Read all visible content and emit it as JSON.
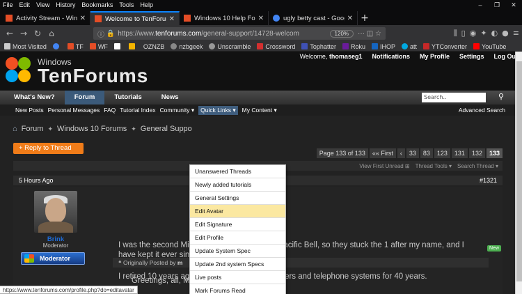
{
  "menubar": [
    "File",
    "Edit",
    "View",
    "History",
    "Bookmarks",
    "Tools",
    "Help"
  ],
  "window_controls": {
    "minimize": "–",
    "restore": "❐",
    "close": "✕"
  },
  "tabs": [
    {
      "title": "Activity Stream - Windows",
      "favicon_color": "#e44d26",
      "active": false
    },
    {
      "title": "Welcome to TenForums - h",
      "favicon_color": "#e44d26",
      "active": true
    },
    {
      "title": "Windows 10 Help Forums",
      "favicon_color": "#e44d26",
      "active": false
    },
    {
      "title": "ugly betty cast - Google Se",
      "favicon_color": "#4285f4",
      "active": false
    }
  ],
  "toolbar": {
    "url_prefix": "https://www.",
    "url_host": "tenforums.com",
    "url_path": "/general-support/14728-welcom",
    "zoom": "120%"
  },
  "bookmarks": [
    {
      "label": "Most Visited",
      "color": "#ccc"
    },
    {
      "label": "",
      "color": "#4285f4"
    },
    {
      "label": "TF",
      "color": "#e44d26"
    },
    {
      "label": "WF",
      "color": "#e44d26"
    },
    {
      "label": "",
      "color": "#fff"
    },
    {
      "label": "",
      "color": "#f4b400"
    },
    {
      "label": "OZNZB",
      "color": "#ccc"
    },
    {
      "label": "nzbgeek",
      "color": "#888"
    },
    {
      "label": "Unscramble",
      "color": "#999"
    },
    {
      "label": "Crossword",
      "color": "#d32f2f"
    },
    {
      "label": "Tophatter",
      "color": "#3f51b5"
    },
    {
      "label": "Roku",
      "color": "#6a1b9a"
    },
    {
      "label": "IHOP",
      "color": "#1565c0"
    },
    {
      "label": "att",
      "color": "#00a8e0"
    },
    {
      "label": "YTConverter",
      "color": "#c62828"
    },
    {
      "label": "YouTube",
      "color": "#ff0000"
    }
  ],
  "site": {
    "logo_small": "Windows",
    "logo_big": "TenForums",
    "welcome": "Welcome,",
    "username": "thomaseg1",
    "toplinks": [
      "Notifications",
      "My Profile",
      "Settings",
      "Log Out"
    ],
    "mainnav": [
      "What's New?",
      "Forum",
      "Tutorials",
      "News"
    ],
    "search_placeholder": "Search..",
    "subnav": [
      "New Posts",
      "Personal Messages",
      "FAQ",
      "Tutorial Index",
      "Community ▾",
      "Quick Links ▾",
      "My Content ▾"
    ],
    "advanced_search": "Advanced Search",
    "breadcrumbs": [
      "Forum",
      "Windows 10 Forums",
      "General Suppo"
    ],
    "reply_button": "+ Reply to Thread",
    "pager": [
      "Page 133 of 133",
      "«« First",
      "‹",
      "33",
      "83",
      "123",
      "131",
      "132",
      "133"
    ],
    "thread_tools": [
      "View First Unread ⊞",
      "Thread Tools ▾",
      "Search Thread ▾"
    ],
    "post": {
      "time": "5 Hours Ago",
      "number": "#1321",
      "user": "Brink",
      "role": "Moderator",
      "badge": "Moderator",
      "new_badge": "New",
      "quote_prefix": "Originally Posted by",
      "quote_user": "m",
      "lines": [
        "Greetings, all, Micha",
        "I was the second Michael L when I started at Pacific Bell, so they stuck the 1 after my name, and I",
        "have kept it ever since...",
        "I retired 10 years ago after playing with computers and telephone systems for 40 years."
      ]
    }
  },
  "quick_links_menu": [
    "Unanswered Threads",
    "Newly added tutorials",
    "General Settings",
    "Edit Avatar",
    "Edit Signature",
    "Edit Profile",
    "Update System Spec",
    "Update 2nd system Specs",
    "Live posts",
    "Mark Forums Read"
  ],
  "quick_links_highlighted": "Edit Avatar",
  "status_url": "https://www.tenforums.com/profile.php?do=editavatar"
}
